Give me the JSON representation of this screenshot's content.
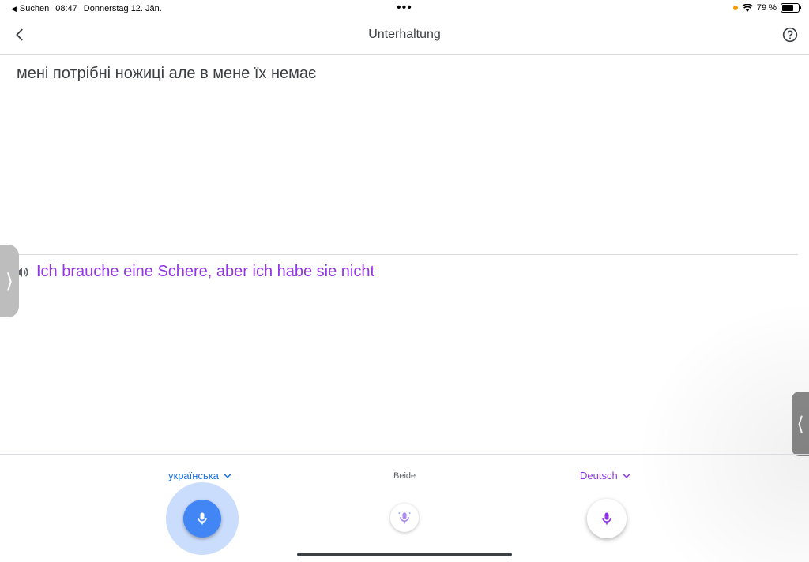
{
  "status_bar": {
    "back_app": "Suchen",
    "time": "08:47",
    "date": "Donnerstag 12. Jän.",
    "battery_text": "79 %",
    "battery_level": 0.79
  },
  "header": {
    "title": "Unterhaltung"
  },
  "conversation": {
    "source_text": "мені потрібні ножиці але в мене їх немає",
    "translated_text": "Ich brauche eine Schere, aber ich habe sie nicht"
  },
  "controls": {
    "left_language": "українська",
    "both_label": "Beide",
    "right_language": "Deutsch"
  },
  "colors": {
    "accent_blue": "#4285f4",
    "accent_purple": "#9334e6"
  },
  "icons": [
    "back-arrow-icon",
    "help-icon",
    "speaker-icon",
    "mic-icon",
    "chevron-down-icon",
    "wifi-icon",
    "battery-icon"
  ]
}
